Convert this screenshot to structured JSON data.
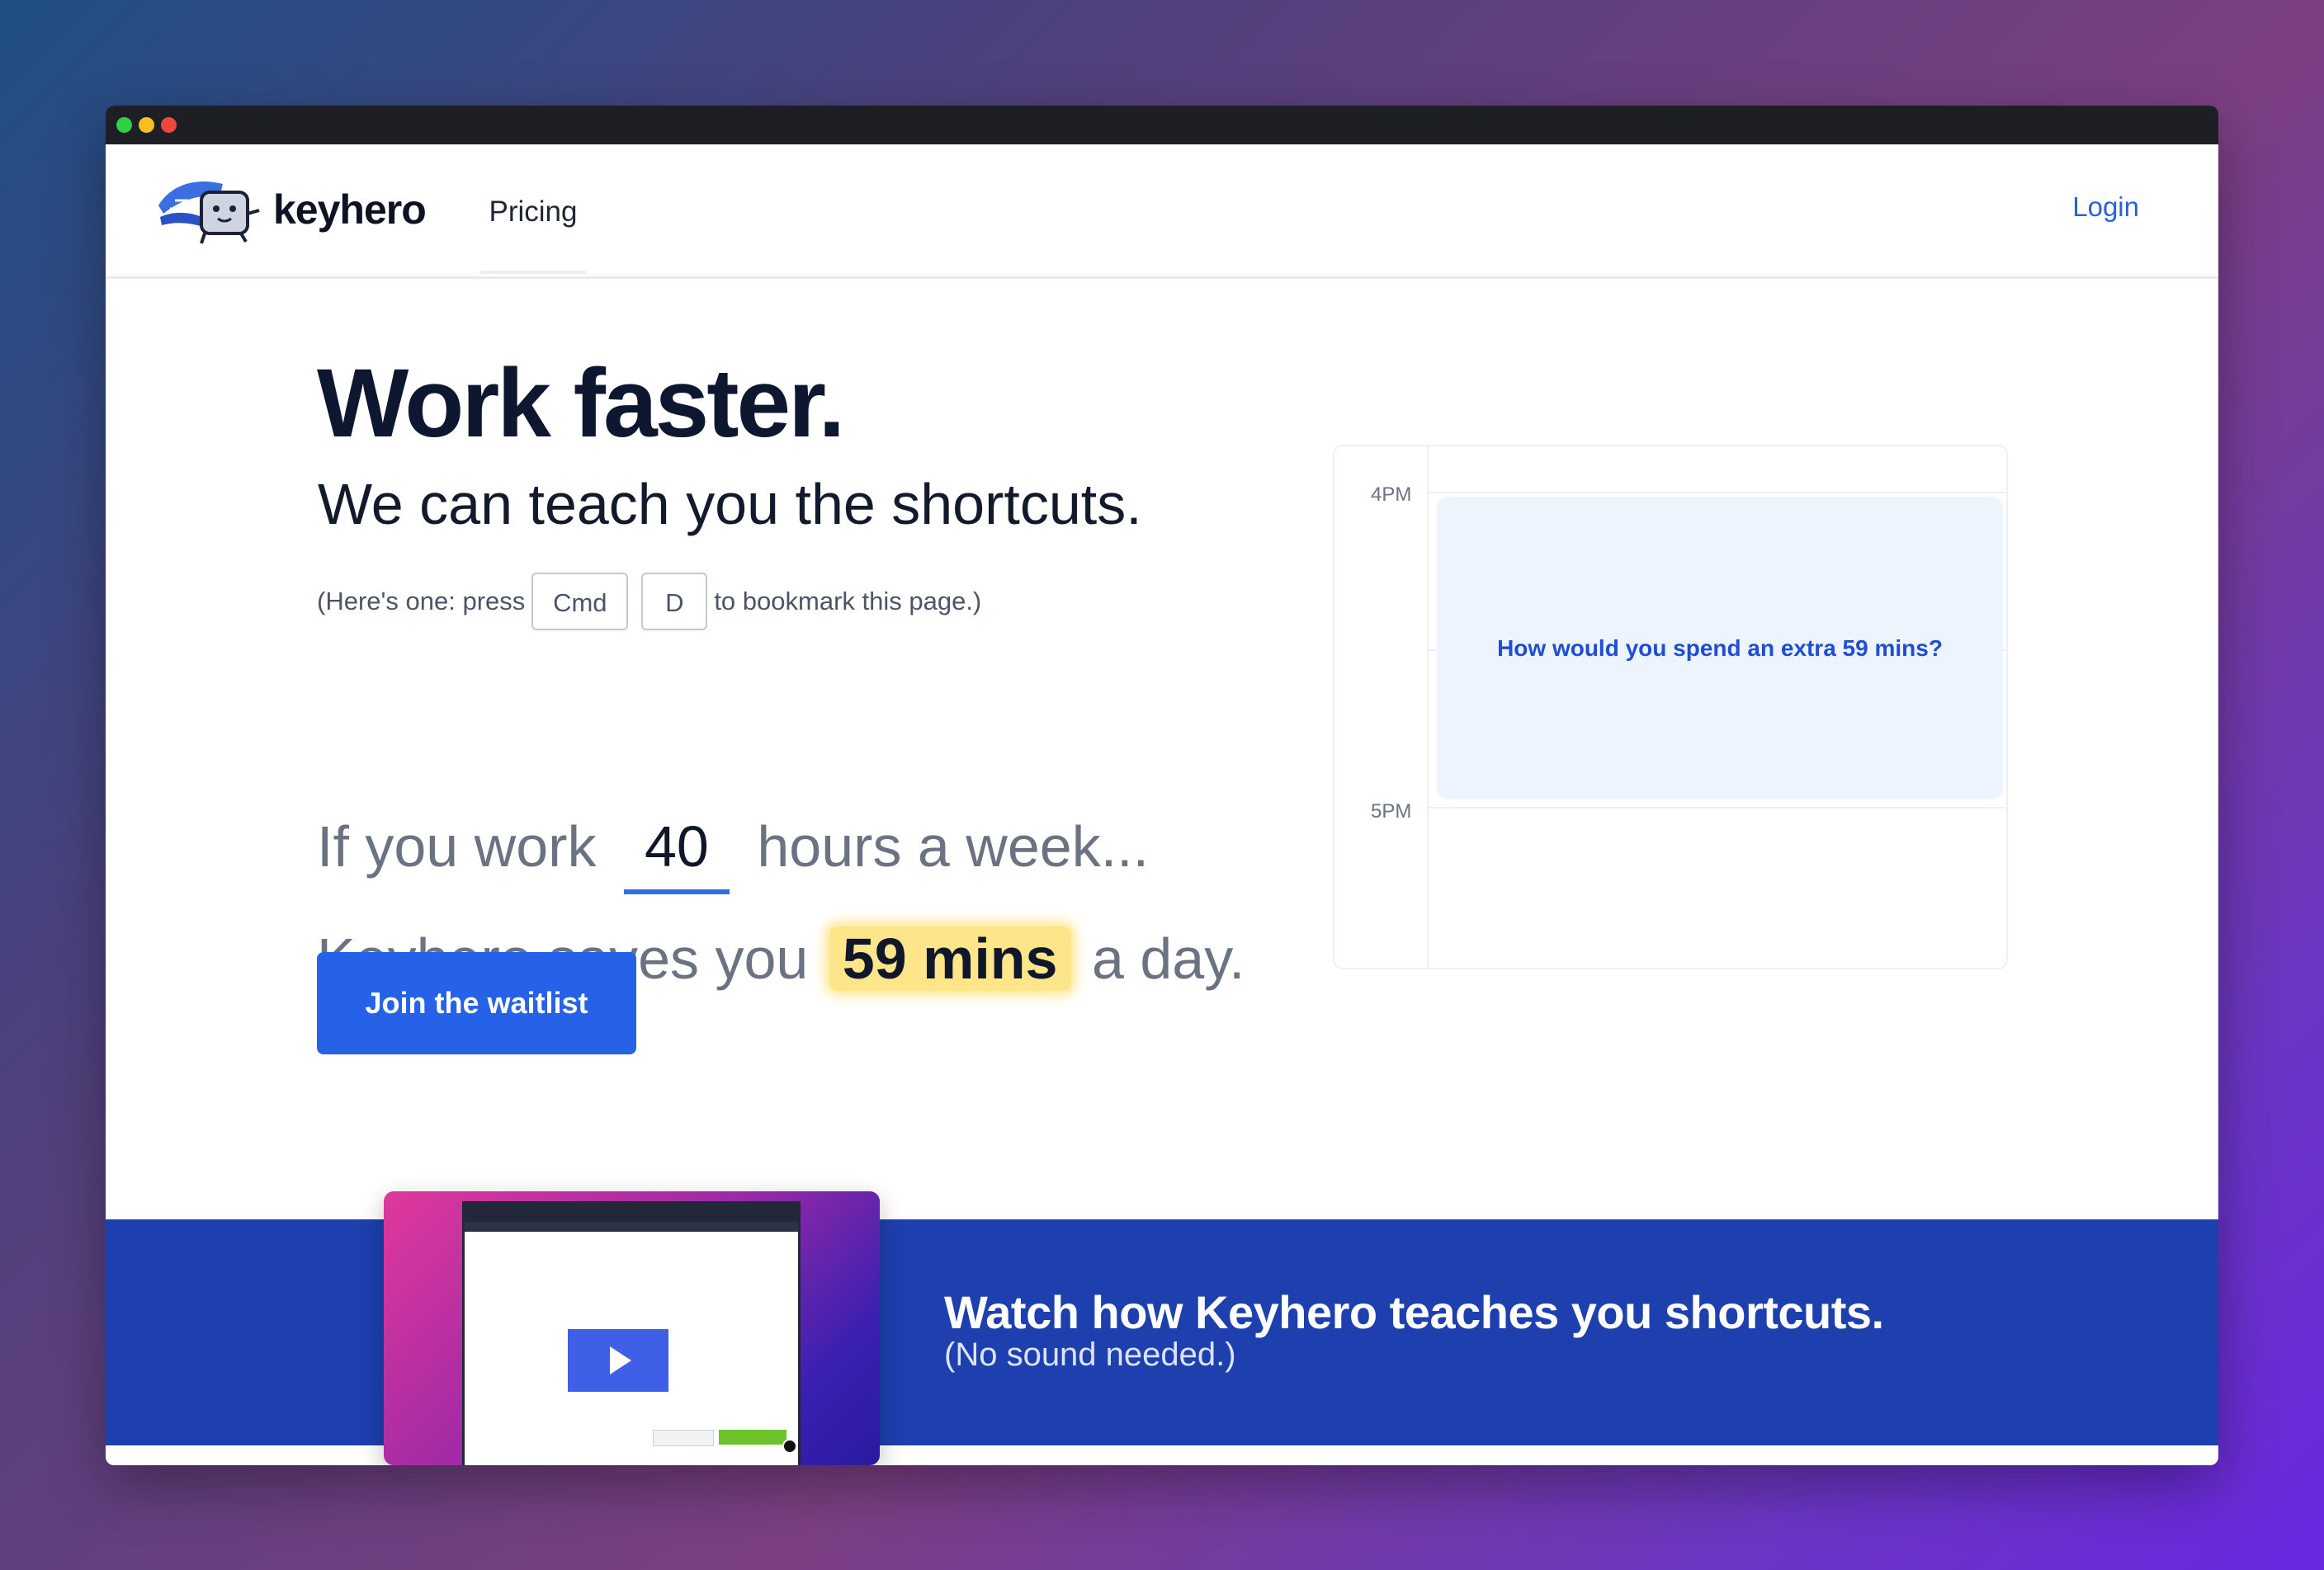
{
  "window": {
    "controls": [
      "green",
      "yellow",
      "red"
    ]
  },
  "nav": {
    "brand": "keyhero",
    "links": [
      {
        "label": "Pricing"
      }
    ],
    "login": "Login"
  },
  "hero": {
    "title": "Work faster.",
    "subtitle": "We can teach you the shortcuts.",
    "hint": {
      "prefix": "(Here's one: press",
      "keys": [
        "Cmd",
        "D"
      ],
      "suffix": "to bookmark this page.)"
    }
  },
  "calculator": {
    "prefix": "If you work",
    "hours": "40",
    "suffix": "hours a week...",
    "result_prefix": "Keyhero saves you",
    "result_value": "59 mins",
    "result_suffix": "a day."
  },
  "cta": {
    "label": "Join the waitlist"
  },
  "calendar": {
    "times": [
      "4PM",
      "5PM"
    ],
    "event": "How would you spend an extra 59 mins?"
  },
  "video_section": {
    "title": "Watch how Keyhero teaches you shortcuts.",
    "subtitle": "(No sound needed.)"
  },
  "icons": {
    "logo": "keyhero-mascot-icon",
    "play": "play-icon"
  },
  "colors": {
    "accent": "#2562e8",
    "band": "#1d40ae",
    "highlight": "#fde68a",
    "link": "#2a60d8"
  }
}
